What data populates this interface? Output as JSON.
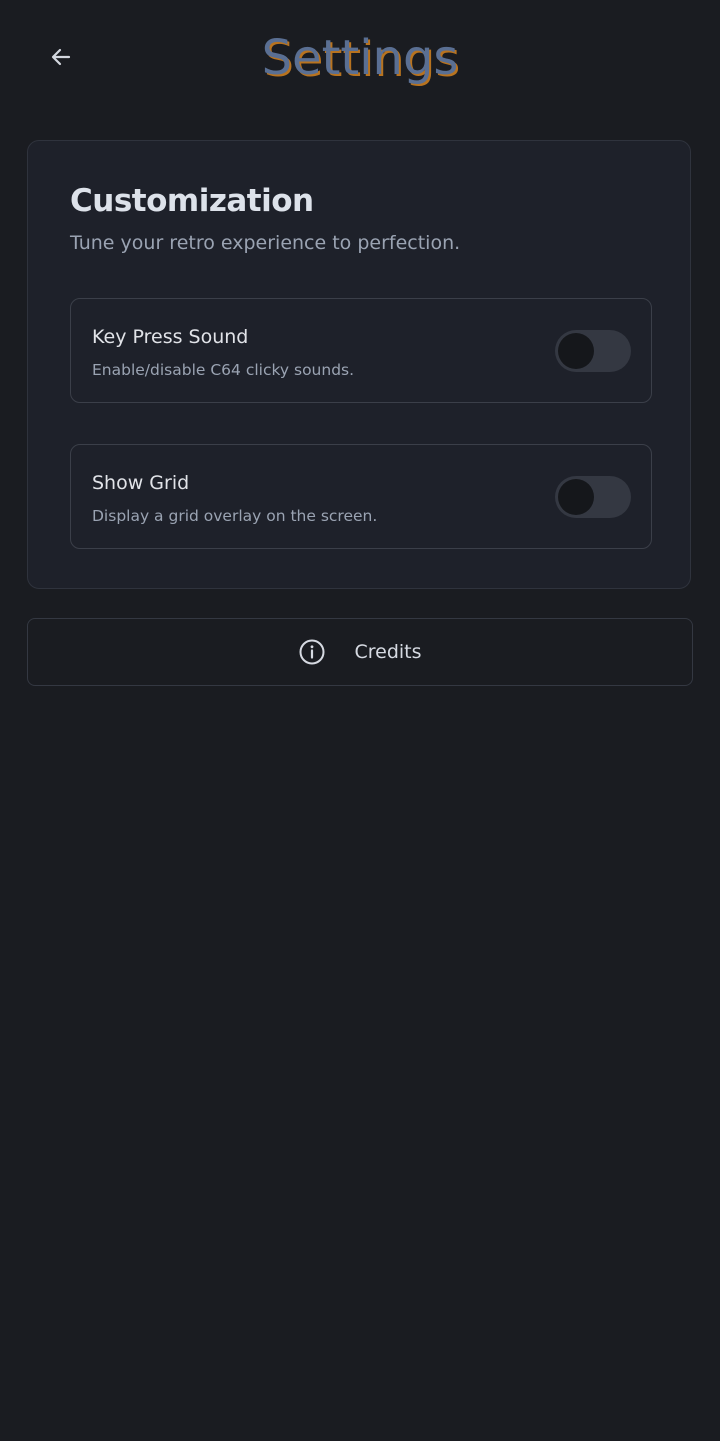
{
  "header": {
    "title": "Settings",
    "back_icon": "arrow-left-icon"
  },
  "customization": {
    "title": "Customization",
    "subtitle": "Tune your retro experience to perfection.",
    "settings": [
      {
        "label": "Key Press Sound",
        "description": "Enable/disable C64 clicky sounds.",
        "enabled": false
      },
      {
        "label": "Show Grid",
        "description": "Display a grid overlay on the screen.",
        "enabled": false
      }
    ]
  },
  "credits": {
    "label": "Credits",
    "icon": "info-icon"
  },
  "colors": {
    "background": "#1a1c21",
    "card": "#1e212a",
    "title_fill": "#5a6f93",
    "title_shadow": "#b8731f",
    "toggle_track": "#343842",
    "toggle_knob": "#15171b"
  }
}
